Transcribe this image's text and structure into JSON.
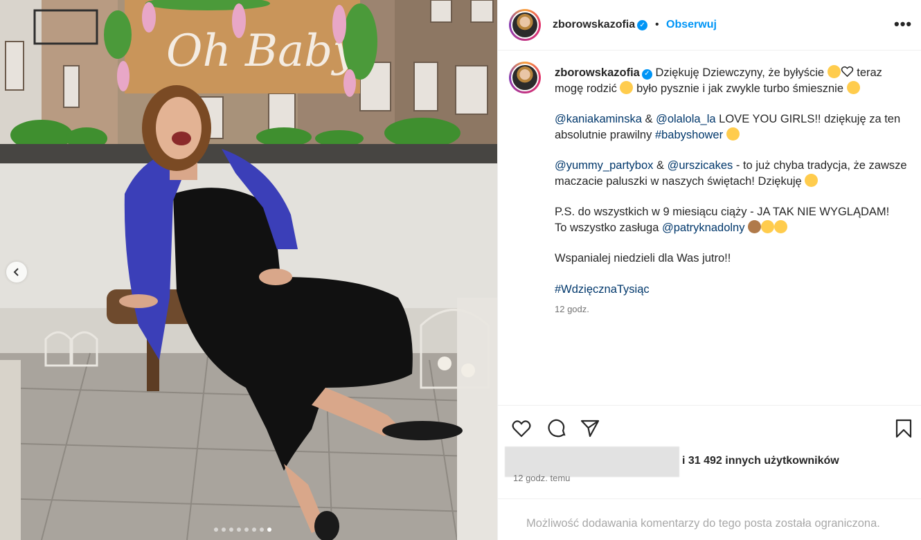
{
  "post": {
    "username": "zborowskazofia",
    "follow_label": "Obserwuj",
    "more_label": "•••",
    "separator": "•"
  },
  "photo": {
    "sign_text": "Oh Baby",
    "carousel": {
      "count": 8,
      "active_index": 7
    }
  },
  "caption": {
    "username": "zborowskazofia",
    "line1_text": "Dziękuję Dziewczyny, że byłyście",
    "line1_rest": "teraz",
    "line2_a": "mogę rodzić",
    "line2_b": "było pysznie i jak zwykle turbo śmiesznie",
    "p2_mention1": "@kaniakaminska",
    "p2_amp": "&",
    "p2_mention2": "@olalola_la",
    "p2_text": "LOVE YOU GIRLS!! dziękuję za ten absolutnie prawilny",
    "p2_hashtag": "#babyshower",
    "p3_mention1": "@yummy_partybox",
    "p3_amp": "&",
    "p3_mention2": "@urszicakes",
    "p3_text": "- to już chyba tradycja, że zawsze maczacie paluszki w naszych świętach! Dziękuję",
    "p4_text1": "P.S. do wszystkich w 9 miesiącu ciąży - JA TAK NIE WYGLĄDAM!",
    "p4_text2": "To wszystko zasługa",
    "p4_mention": "@patryknadolny",
    "p5_text": "Wspanialej niedzieli dla Was jutro!!",
    "p6_hashtag": "#WdzięcznaTysiąc",
    "time": "12 godz."
  },
  "actions": {
    "likes_text": "i 31 492 innych użytkowników",
    "post_time": "12 godz. temu",
    "comments_limited": "Możliwość dodawania komentarzy do tego posta została ograniczona."
  },
  "icons": {
    "like": "heart-icon",
    "comment": "comment-icon",
    "share": "share-icon",
    "save": "bookmark-icon",
    "prev": "chevron-left-icon",
    "verified": "verified-badge-icon"
  },
  "colors": {
    "link": "#00376b",
    "accent": "#0095f6",
    "jacket": "#3b3fb8",
    "dress": "#111111",
    "sign": "#c9955a"
  }
}
